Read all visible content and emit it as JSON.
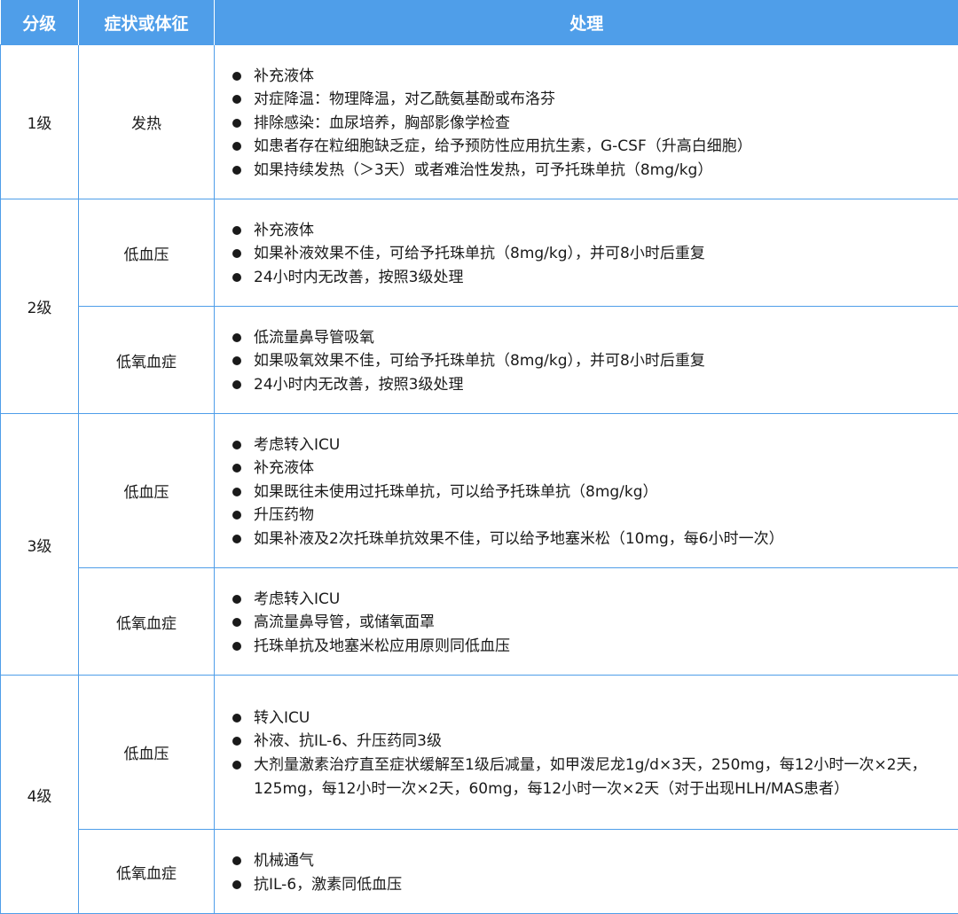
{
  "headers": [
    "分级",
    "症状或体征",
    "处理"
  ],
  "rows": [
    {
      "grade": "1级",
      "symptom": "发热",
      "items": [
        "补充液体",
        "对症降温：物理降温，对乙酰氨基酚或布洛芬",
        "排除感染：血尿培养，胸部影像学检查",
        "如患者存在粒细胞缺乏症，给予预防性应用抗生素，G-CSF（升高白细胞）",
        "如果持续发热（＞3天）或者难治性发热，可予托珠单抗（8mg/kg）"
      ]
    },
    {
      "grade": "2级",
      "symptom": "低血压",
      "items": [
        "补充液体",
        "如果补液效果不佳，可给予托珠单抗（8mg/kg），并可8小时后重复",
        "24小时内无改善，按照3级处理"
      ]
    },
    {
      "symptom": "低氧血症",
      "items": [
        "低流量鼻导管吸氧",
        "如果吸氧效果不佳，可给予托珠单抗（8mg/kg），并可8小时后重复",
        "24小时内无改善，按照3级处理"
      ]
    },
    {
      "grade": "3级",
      "symptom": "低血压",
      "items": [
        "考虑转入ICU",
        "补充液体",
        "如果既往未使用过托珠单抗，可以给予托珠单抗（8mg/kg）",
        "升压药物",
        "如果补液及2次托珠单抗效果不佳，可以给予地塞米松（10mg，每6小时一次）"
      ]
    },
    {
      "symptom": "低氧血症",
      "items": [
        "考虑转入ICU",
        "高流量鼻导管，或储氧面罩",
        "托珠单抗及地塞米松应用原则同低血压"
      ]
    },
    {
      "grade": "4级",
      "symptom": "低血压",
      "items": [
        "转入ICU",
        "补液、抗IL-6、升压药同3级",
        "大剂量激素治疗直至症状缓解至1级后减量，如甲泼尼龙1g/d×3天，250mg，每12小时一次×2天，125mg，每12小时一次×2天，60mg，每12小时一次×2天（对于出现HLH/MAS患者）"
      ]
    },
    {
      "symptom": "低氧血症",
      "items": [
        "机械通气",
        "抗IL-6，激素同低血压"
      ]
    }
  ]
}
